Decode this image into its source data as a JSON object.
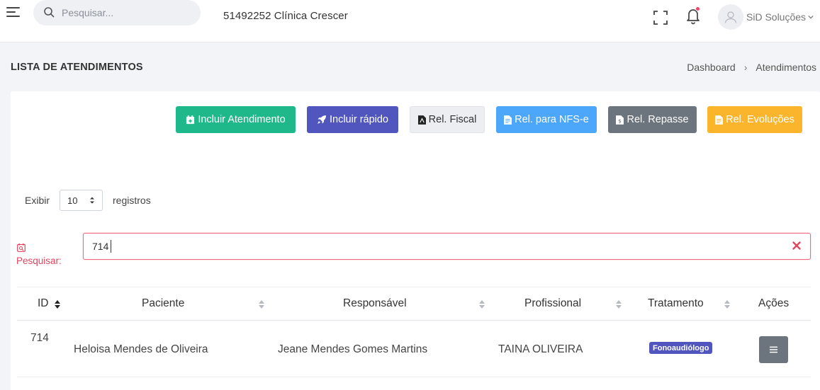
{
  "header": {
    "search_placeholder": "Pesquisar...",
    "company": "51492252 Clínica Crescer",
    "user_name": "SiD Soluções",
    "notification_color": "#f0446c"
  },
  "page": {
    "title": "LISTA DE ATENDIMENTOS",
    "breadcrumb": [
      "Dashboard",
      "Atendimentos"
    ]
  },
  "toolbar": {
    "buttons": [
      {
        "label": "Incluir Atendimento",
        "color": "#1fb88a",
        "icon": "calendar-plus-icon"
      },
      {
        "label": "Incluir rápido",
        "color": "#5156be",
        "icon": "rocket-icon"
      },
      {
        "label": "Rel. Fiscal",
        "color": "#eceef2",
        "icon": "file-pdf-icon"
      },
      {
        "label": "Rel. para NFS-e",
        "color": "#4ca6f9",
        "icon": "file-text-icon"
      },
      {
        "label": "Rel. Repasse",
        "color": "#6c757d",
        "icon": "file-dollar-icon"
      },
      {
        "label": "Rel. Evoluções",
        "color": "#fbb52d",
        "icon": "file-text-icon"
      }
    ]
  },
  "list_controls": {
    "show_label": "Exibir",
    "page_size": "10",
    "records_label": "registros",
    "filter_label": "Pesquisar:",
    "filter_value": "714"
  },
  "table": {
    "columns": [
      "ID",
      "Paciente",
      "Responsável",
      "Profissional",
      "Tratamento",
      "Ações"
    ],
    "sorted_column": "ID",
    "rows": [
      {
        "id": "714",
        "paciente": "Heloisa Mendes de Oliveira",
        "responsavel": "Jeane Mendes Gomes Martins",
        "profissional": "TAINA OLIVEIRA",
        "tratamento": "Fonoaudiólogo"
      }
    ]
  }
}
